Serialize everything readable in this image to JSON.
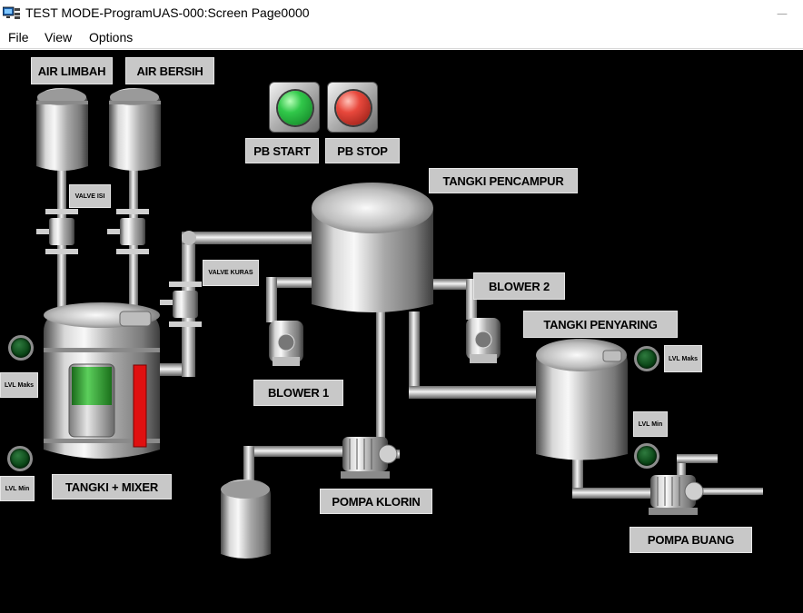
{
  "window": {
    "title": "TEST MODE-ProgramUAS-000:Screen Page0000",
    "app_icon": "monitor-icon"
  },
  "menu": {
    "items": [
      "File",
      "View",
      "Options"
    ]
  },
  "labels": {
    "air_limbah": "AIR LIMBAH",
    "air_bersih": "AIR BERSIH",
    "pb_start": "PB START",
    "pb_stop": "PB STOP",
    "valve_isi": "VALVE ISI",
    "valve_kuras": "VALVE KURAS",
    "tangki_pencampur": "TANGKI PENCAMPUR",
    "blower_1": "BLOWER 1",
    "blower_2": "BLOWER 2",
    "tangki_penyaring": "TANGKI PENYARING",
    "tangki_mixer": "TANGKI + MIXER",
    "pompa_klorin": "POMPA KLORIN",
    "pompa_buang": "POMPA BUANG",
    "lvl_maks_left": "LVL Maks",
    "lvl_min_left": "LVL Min",
    "lvl_maks_right": "LVL Maks",
    "lvl_min_right": "LVL Min"
  },
  "colors": {
    "background": "#000000",
    "label_bg": "#c8c8c8",
    "start_lamp": "#31c84a",
    "stop_lamp": "#e8483c",
    "level_indicator_off": "#0a4516",
    "mixer_level_fill": "#2a9a2a",
    "mixer_bar": "#e01010"
  }
}
